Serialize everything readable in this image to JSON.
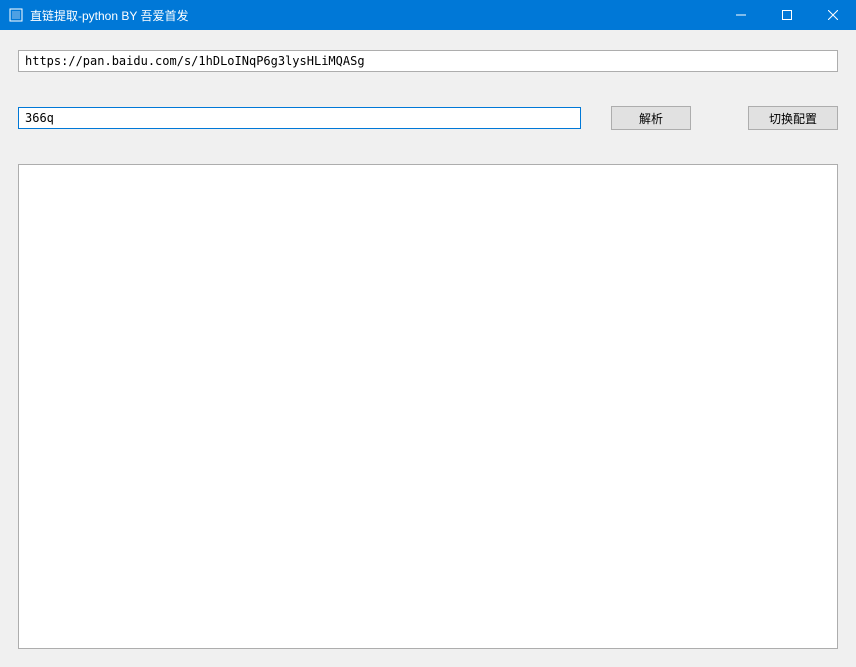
{
  "window": {
    "title": "直链提取-python BY 吾爱首发"
  },
  "inputs": {
    "url_value": "https://pan.baidu.com/s/1hDLoINqP6g3lysHLiMQASg",
    "code_value": "366q"
  },
  "buttons": {
    "parse_label": "解析",
    "switch_config_label": "切换配置"
  },
  "output": {
    "content": ""
  }
}
